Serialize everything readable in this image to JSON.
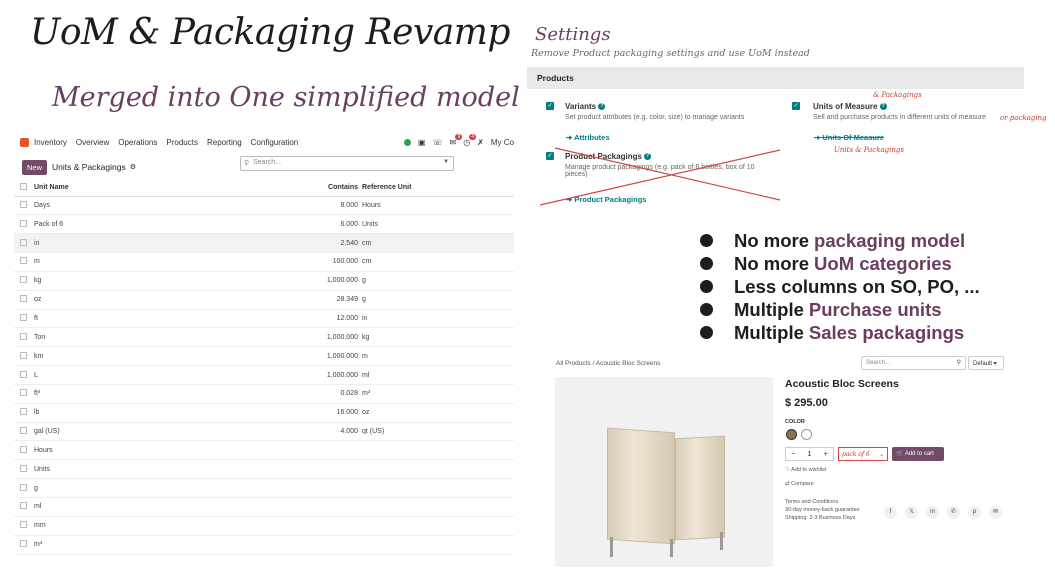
{
  "title": "UoM & Packaging Revamp",
  "subtitle": "Merged into One simplified model",
  "inventory": {
    "app_name": "Inventory",
    "menu": [
      "Overview",
      "Operations",
      "Products",
      "Reporting",
      "Configuration"
    ],
    "badges": [
      "9",
      "4"
    ],
    "company": "My Co",
    "new_button": "New",
    "page_title": "Units & Packagings",
    "search_placeholder": "Search...",
    "columns": [
      "Unit Name",
      "Contains",
      "Reference Unit"
    ],
    "rows": [
      {
        "name": "Days",
        "contains": "8.000",
        "ref": "Hours"
      },
      {
        "name": "Pack of 6",
        "contains": "6.000",
        "ref": "Units"
      },
      {
        "name": "in",
        "contains": "2.540",
        "ref": "cm"
      },
      {
        "name": "m",
        "contains": "100.000",
        "ref": "cm"
      },
      {
        "name": "kg",
        "contains": "1,000.000",
        "ref": "g"
      },
      {
        "name": "oz",
        "contains": "28.349",
        "ref": "g"
      },
      {
        "name": "ft",
        "contains": "12.000",
        "ref": "in"
      },
      {
        "name": "Ton",
        "contains": "1,000.000",
        "ref": "kg"
      },
      {
        "name": "km",
        "contains": "1,000.000",
        "ref": "m"
      },
      {
        "name": "L",
        "contains": "1,000.000",
        "ref": "ml"
      },
      {
        "name": "ft³",
        "contains": "0.028",
        "ref": "m³"
      },
      {
        "name": "lb",
        "contains": "16.000",
        "ref": "oz"
      },
      {
        "name": "gal (US)",
        "contains": "4.000",
        "ref": "qt (US)"
      },
      {
        "name": "Hours",
        "contains": "",
        "ref": ""
      },
      {
        "name": "Units",
        "contains": "",
        "ref": ""
      },
      {
        "name": "g",
        "contains": "",
        "ref": ""
      },
      {
        "name": "ml",
        "contains": "",
        "ref": ""
      },
      {
        "name": "mm",
        "contains": "",
        "ref": ""
      },
      {
        "name": "m³",
        "contains": "",
        "ref": ""
      }
    ]
  },
  "settings": {
    "title": "Settings",
    "description": "Remove Product packaging settings and use UoM instead",
    "section": "Products",
    "variants": {
      "title": "Variants",
      "desc": "Set product attributes (e.g. color, size) to manage variants",
      "link": "Attributes"
    },
    "uom": {
      "title": "Units of Measure",
      "desc": "Sell and purchase products in different units of measure",
      "link": "Units Of Measure"
    },
    "packagings": {
      "title": "Product Packagings",
      "desc": "Manage product packagings (e.g. pack of 6 bottles, box of 10 pieces)",
      "link": "Product Packagings"
    },
    "notes": {
      "above": "& Packagings",
      "right": "or packaging",
      "below": "Units & Packagings"
    }
  },
  "bullets": [
    {
      "text": "No more",
      "accent": "packaging model"
    },
    {
      "text": "No more",
      "accent": "UoM categories"
    },
    {
      "text": "Less columns on SO, PO, ...",
      "accent": ""
    },
    {
      "text": "Multiple",
      "accent": "Purchase units"
    },
    {
      "text": "Multiple",
      "accent": "Sales packagings"
    }
  ],
  "shop": {
    "breadcrumb": "All Products / Acoustic Bloc Screens",
    "search_placeholder": "Search...",
    "sort": "Default",
    "product_name": "Acoustic Bloc Screens",
    "price": "$ 295.00",
    "color_label": "COLOR",
    "quantity": "1",
    "packaging_select": "pack of 6",
    "add_to_cart": "Add to cart",
    "wishlist": "Add to wishlist",
    "compare": "Compare",
    "terms": "Terms and Conditions",
    "guarantee": "30-day money-back guarantee",
    "shipping": "Shipping: 2-3 Business Days",
    "colors": {
      "swatch1": "#8b7355",
      "swatch2": "#ffffff",
      "accent": "#714b67"
    }
  }
}
